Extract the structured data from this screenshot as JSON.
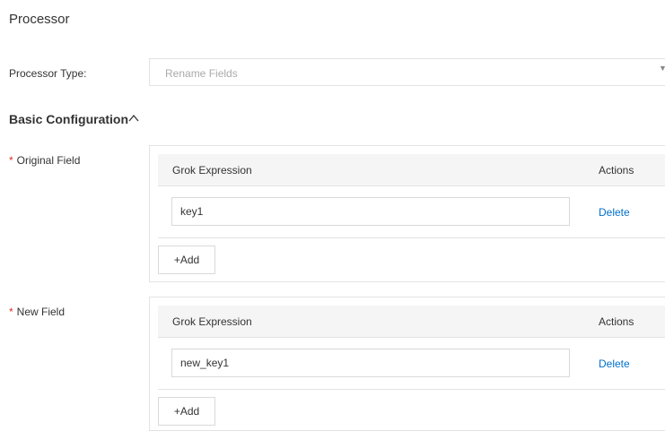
{
  "page": {
    "title": "Processor"
  },
  "processor_type": {
    "label": "Processor Type:",
    "value": "Rename Fields",
    "caret_icon": "chevron-down-icon"
  },
  "basic_configuration": {
    "title": "Basic Configuration",
    "toggle_icon": "chevron-up-icon",
    "required_mark": "*",
    "original_field": {
      "label": "Original Field",
      "columns": {
        "expression": "Grok Expression",
        "actions": "Actions"
      },
      "rows": [
        {
          "value": "key1",
          "action": "Delete"
        }
      ],
      "add_label": "+Add"
    },
    "new_field": {
      "label": "New Field",
      "columns": {
        "expression": "Grok Expression",
        "actions": "Actions"
      },
      "rows": [
        {
          "value": "new_key1",
          "action": "Delete"
        }
      ],
      "add_label": "+Add"
    }
  },
  "colors": {
    "accent_link": "#0070cc",
    "required": "#d93026",
    "border": "#e3e3e3",
    "header_bg": "#f5f5f5"
  }
}
